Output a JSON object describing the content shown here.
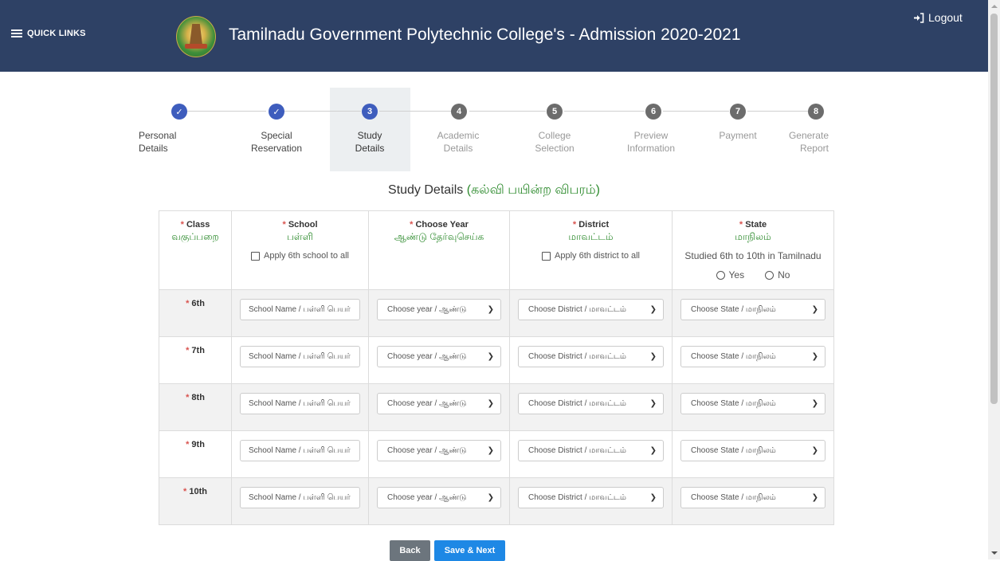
{
  "header": {
    "quick_links": "QUICK LINKS",
    "title": "Tamilnadu Government Polytechnic College's - Admission 2020-2021",
    "logout": "Logout"
  },
  "steps": [
    {
      "num": "✓",
      "label_1": "Personal",
      "label_2": "Details",
      "state": "done"
    },
    {
      "num": "✓",
      "label_1": "Special",
      "label_2": "Reservation",
      "state": "done"
    },
    {
      "num": "3",
      "label_1": "Study",
      "label_2": "Details",
      "state": "current"
    },
    {
      "num": "4",
      "label_1": "Academic",
      "label_2": "Details",
      "state": "todo"
    },
    {
      "num": "5",
      "label_1": "College",
      "label_2": "Selection",
      "state": "todo"
    },
    {
      "num": "6",
      "label_1": "Preview",
      "label_2": "Information",
      "state": "todo"
    },
    {
      "num": "7",
      "label_1": "Payment",
      "label_2": "",
      "state": "todo"
    },
    {
      "num": "8",
      "label_1": "Generate",
      "label_2": "Report",
      "state": "todo"
    }
  ],
  "section": {
    "title_en": "Study Details",
    "title_ta": "(கல்வி பயின்ற விபரம்)"
  },
  "columns": {
    "class": {
      "req": "*",
      "en": "Class",
      "ta": "வகுப்பறை"
    },
    "school": {
      "req": "*",
      "en": "School",
      "ta": "பள்ளி",
      "check_label": "Apply 6th school to all"
    },
    "year": {
      "req": "*",
      "en": "Choose Year",
      "ta": "ஆண்டு தேர்வுசெய்க"
    },
    "district": {
      "req": "*",
      "en": "District",
      "ta": "மாவட்டம்",
      "check_label": "Apply 6th district to all"
    },
    "state": {
      "req": "*",
      "en": "State",
      "ta": "மாநிலம்",
      "note": "Studied 6th to 10th in Tamilnadu",
      "yes": "Yes",
      "no": "No"
    }
  },
  "rows": [
    {
      "label": "6th"
    },
    {
      "label": "7th"
    },
    {
      "label": "8th"
    },
    {
      "label": "9th"
    },
    {
      "label": "10th"
    }
  ],
  "fields": {
    "school_placeholder": "School Name / பள்ளி பெயர்",
    "year_select": "Choose year / ஆண்டு",
    "district_select": "Choose District / மாவட்டம்",
    "state_select": "Choose State / மாநிலம்"
  },
  "buttons": {
    "back": "Back",
    "next": "Save & Next"
  },
  "colors": {
    "header_bg": "#2e4165",
    "step_done": "#3e5dbd",
    "step_todo": "#6c6c6c",
    "tamil_text": "#2e8b2e",
    "required": "#d9534f",
    "button_primary": "#1e88e5",
    "button_secondary": "#6c757d"
  }
}
